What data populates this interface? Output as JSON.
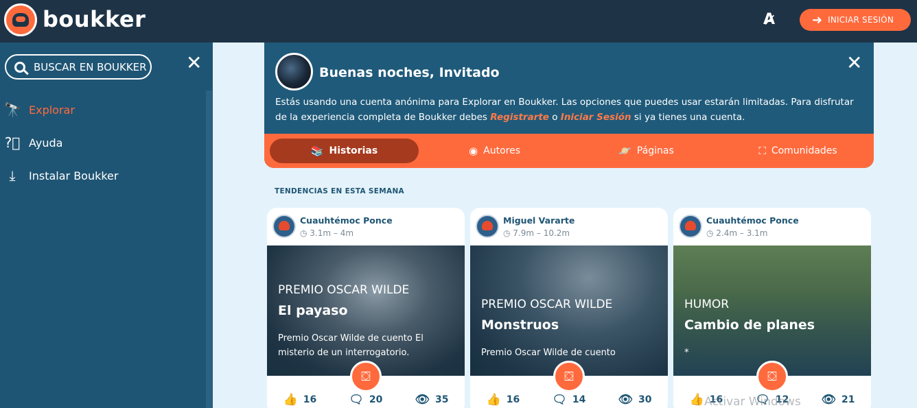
{
  "header": {
    "brand": "boukker",
    "translate_icon": "translate-icon",
    "login_label": "INICIAR SESIÓN",
    "login_icon": "login-arrow-icon"
  },
  "sidebar": {
    "search_label": "BUSCAR EN BOUKKER",
    "items": [
      {
        "label": "Explorar",
        "icon": "telescope-icon",
        "active": true
      },
      {
        "label": "Ayuda",
        "icon": "help-icon",
        "active": false
      },
      {
        "label": "Instalar Boukker",
        "icon": "install-icon",
        "active": false
      }
    ]
  },
  "welcome": {
    "greeting": "Buenas noches, Invitado",
    "text_before": "Estás usando una cuenta anónima para Explorar en Boukker. Las opciones que puedes usar estarán limitadas. Para disfrutar de la experiencia completa de Boukker debes ",
    "link_register": "Registrarte",
    "text_mid": " o ",
    "link_login": "Iniciar Sesión",
    "text_after": " si ya tienes una cuenta."
  },
  "tabs": [
    {
      "label": "Historias",
      "icon": "books-icon",
      "active": true
    },
    {
      "label": "Autores",
      "icon": "author-icon",
      "active": false
    },
    {
      "label": "Páginas",
      "icon": "planet-icon",
      "active": false
    },
    {
      "label": "Comunidades",
      "icon": "community-icon",
      "active": false
    }
  ],
  "section_title": "TENDENCIAS EN ESTA SEMANA",
  "cards": [
    {
      "author": "Cuauhtémoc Ponce",
      "time": "3.1m – 4m",
      "genre": "PREMIO OSCAR WILDE",
      "title": "El payaso",
      "desc": "Premio Oscar Wilde de cuento El misterio de un interrogatorio.",
      "likes": "16",
      "comments": "20",
      "views": "35"
    },
    {
      "author": "Miguel Vararte",
      "time": "7.9m – 10.2m",
      "genre": "PREMIO OSCAR WILDE",
      "title": "Monstruos",
      "desc": "Premio Oscar Wilde de cuento",
      "likes": "16",
      "comments": "14",
      "views": "30"
    },
    {
      "author": "Cuauhtémoc Ponce",
      "time": "2.4m – 3.1m",
      "genre": "HUMOR",
      "title": "Cambio de planes",
      "desc": "*",
      "likes": "16",
      "comments": "12",
      "views": "21"
    }
  ],
  "watermark": "Activar Windows"
}
